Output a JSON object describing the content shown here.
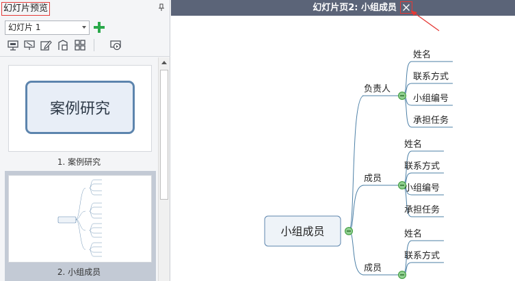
{
  "left_panel": {
    "title": "幻灯片预览",
    "slide_selector": {
      "value": "幻灯片 1"
    },
    "toolbar": [
      "presenter-icon",
      "slide-hide-icon",
      "edit-icon",
      "slide-settings-icon",
      "layout-grid-icon",
      "play-slideshow-icon"
    ],
    "slides": [
      {
        "caption": "1. 案例研究",
        "content": "案例研究"
      },
      {
        "caption": "2. 小组成员",
        "selected": true
      }
    ]
  },
  "main": {
    "title": "幻灯片页2: 小组成员",
    "mindmap": {
      "root": "小组成员",
      "branches": [
        {
          "label": "负责人",
          "children": [
            "姓名",
            "联系方式",
            "小组编号",
            "承担任务"
          ]
        },
        {
          "label": "成员",
          "children": [
            "姓名",
            "联系方式",
            "小组编号",
            "承担任务"
          ]
        },
        {
          "label": "成员",
          "children": [
            "姓名",
            "联系方式"
          ]
        }
      ]
    }
  },
  "colors": {
    "accent_red": "#e53935",
    "title_bar": "#5b6478",
    "branch_line": "#4b7fa6",
    "collapse_green": "#3c9a3c"
  }
}
